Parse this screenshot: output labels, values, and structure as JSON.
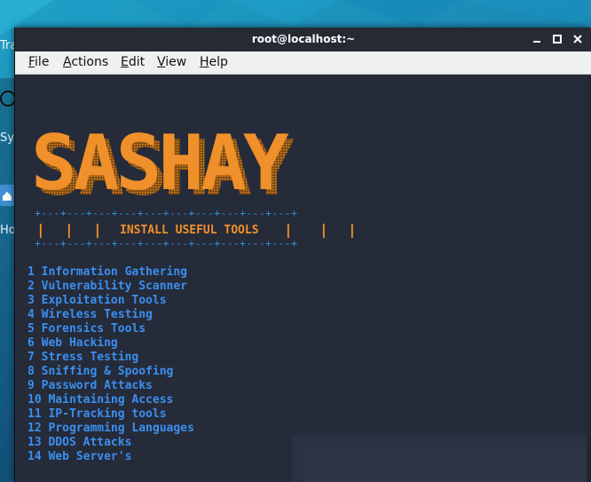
{
  "desktop": {
    "label_trash": "Tra",
    "label_system": "Sy",
    "label_home": "Hor"
  },
  "window": {
    "title": "root@localhost:~",
    "buttons": {
      "minimize": "minimize-icon",
      "maximize": "maximize-icon",
      "close": "close-icon"
    }
  },
  "menubar": {
    "items": [
      "File",
      "Actions",
      "Edit",
      "View",
      "Help"
    ]
  },
  "terminal": {
    "banner_text": "SASHAY",
    "box_top": "+---+---+---+---+---+---+---+---+---+---+",
    "box_title": "INSTALL USEFUL TOOLS",
    "box_bottom": "+---+---+---+---+---+---+---+---+---+---+",
    "options": [
      "1 Information Gathering",
      "2 Vulnerability Scanner",
      "3 Exploitation Tools",
      "4 Wireless Testing",
      "5 Forensics Tools",
      "6 Web Hacking",
      "7 Stress Testing",
      "8 Sniffing & Spoofing",
      "9 Password Attacks",
      "10 Maintaining Access",
      "11 IP-Tracking tools",
      "12 Programming Languages",
      "13 DDOS Attacks",
      "14 Web Server's"
    ]
  },
  "colors": {
    "banner_orange": "#f0902a",
    "box_blue": "#2c8fd6",
    "menu_blue": "#3b8ff0",
    "terminal_bg": "#252b39"
  }
}
